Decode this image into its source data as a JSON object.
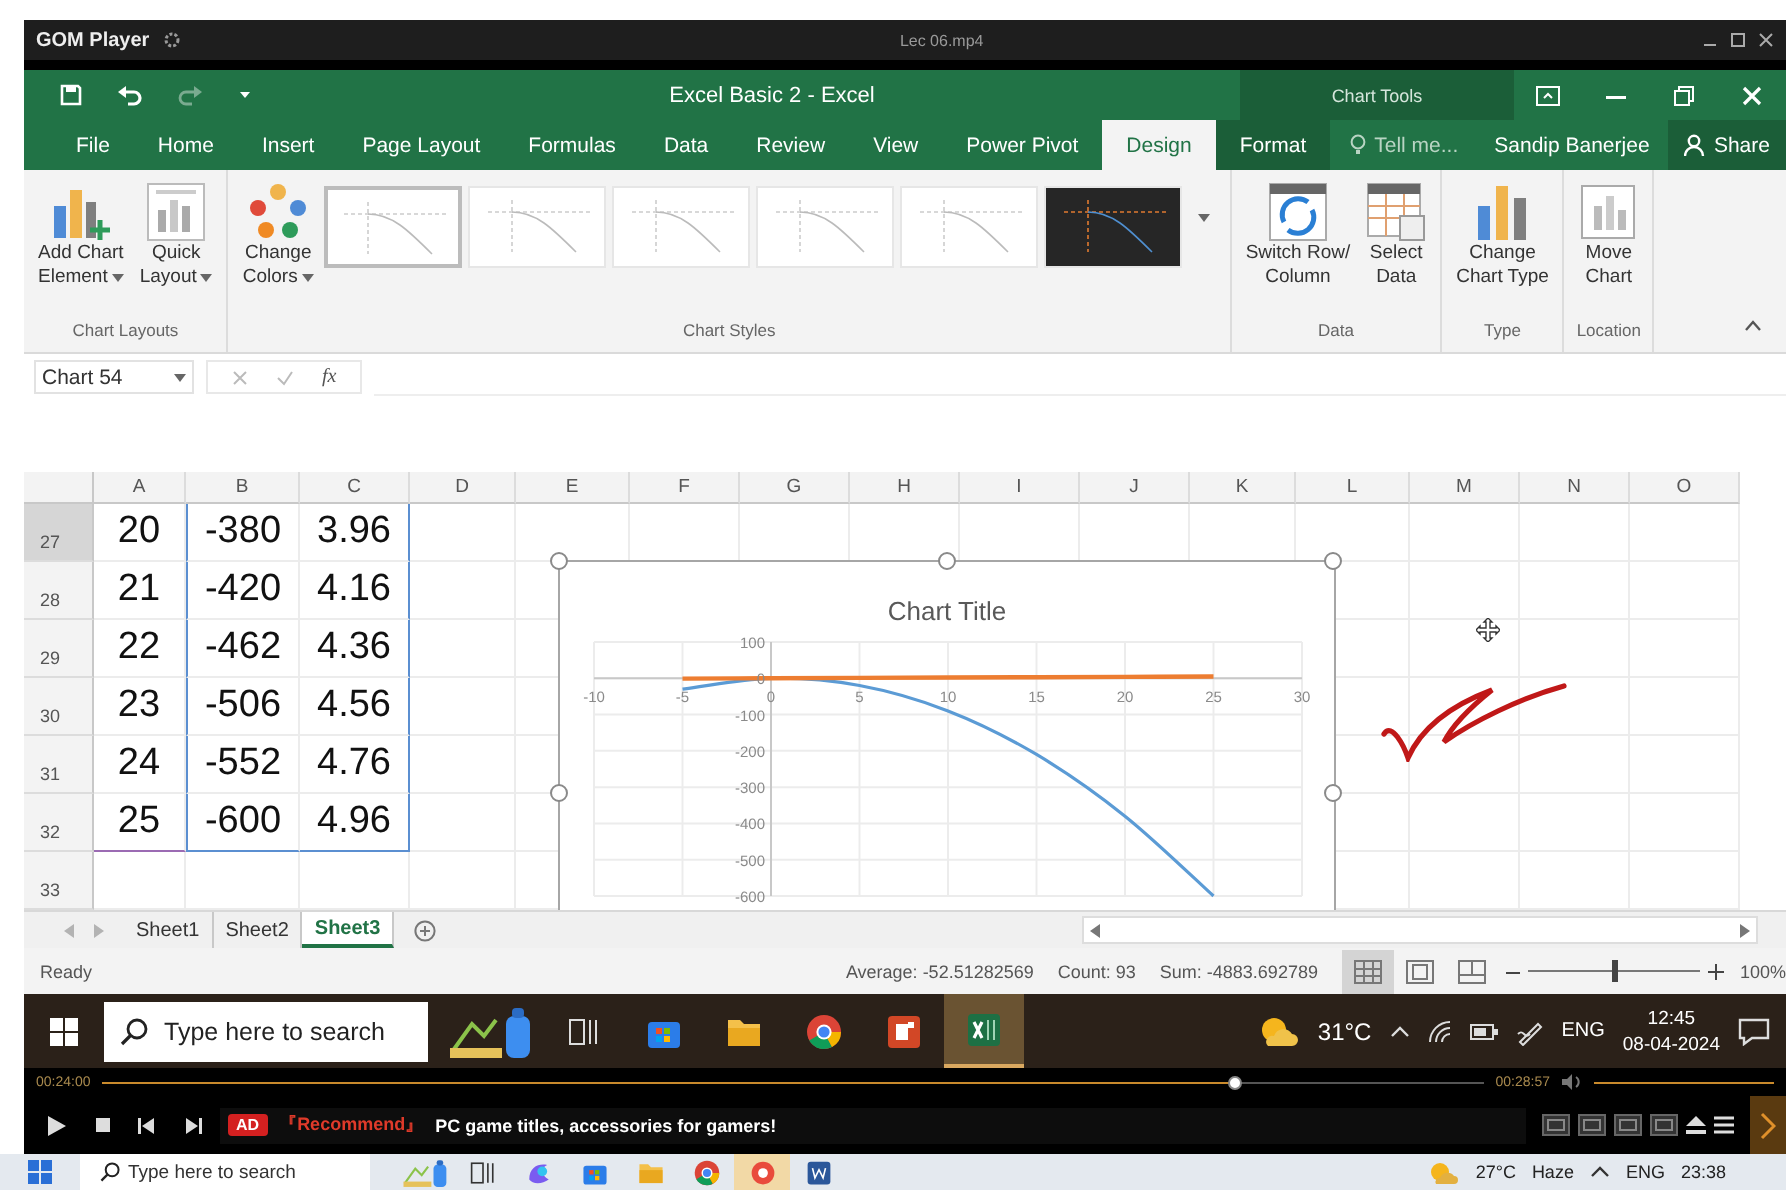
{
  "player": {
    "app_name": "GOM Player",
    "file_name": "Lec 06.mp4"
  },
  "excel": {
    "quick_access": [
      {
        "kind": "save",
        "disabled": false
      },
      {
        "kind": "undo",
        "disabled": false
      },
      {
        "kind": "redo",
        "disabled": true
      },
      {
        "kind": "customize",
        "disabled": false
      }
    ],
    "title": "Excel Basic 2 - Excel",
    "context_label": "Chart Tools",
    "tabs": [
      {
        "label": "File",
        "selected": false,
        "contextual": false
      },
      {
        "label": "Home",
        "selected": false,
        "contextual": false
      },
      {
        "label": "Insert",
        "selected": false,
        "contextual": false
      },
      {
        "label": "Page Layout",
        "selected": false,
        "contextual": false
      },
      {
        "label": "Formulas",
        "selected": false,
        "contextual": false
      },
      {
        "label": "Data",
        "selected": false,
        "contextual": false
      },
      {
        "label": "Review",
        "selected": false,
        "contextual": false
      },
      {
        "label": "View",
        "selected": false,
        "contextual": false
      },
      {
        "label": "Power Pivot",
        "selected": false,
        "contextual": false
      },
      {
        "label": "Design",
        "selected": true,
        "contextual": true
      },
      {
        "label": "Format",
        "selected": false,
        "contextual": true
      }
    ],
    "tell_me": "Tell me...",
    "user": "Sandip Banerjee",
    "share": "Share",
    "ribbon": [
      {
        "label": "Chart Layouts",
        "commands": [
          {
            "kind": "add-chart",
            "lines": [
              "Add Chart",
              "Element"
            ],
            "dropdown": true
          },
          {
            "kind": "quick-layout",
            "lines": [
              "Quick",
              "Layout"
            ],
            "dropdown": true
          }
        ]
      },
      {
        "label": "Chart Styles",
        "commands": [
          {
            "kind": "colors",
            "lines": [
              "Change",
              "Colors"
            ],
            "dropdown": true
          }
        ],
        "styles": [
          {
            "kind": "light",
            "selected": true
          },
          {
            "kind": "light",
            "selected": false
          },
          {
            "kind": "light",
            "selected": false
          },
          {
            "kind": "light",
            "selected": false
          },
          {
            "kind": "light",
            "selected": false
          },
          {
            "kind": "dark",
            "selected": false
          }
        ]
      },
      {
        "label": "Data",
        "commands": [
          {
            "kind": "switch",
            "lines": [
              "Switch Row/",
              "Column"
            ],
            "dropdown": false
          },
          {
            "kind": "select-data",
            "lines": [
              "Select",
              "Data"
            ],
            "dropdown": false
          }
        ]
      },
      {
        "label": "Type",
        "commands": [
          {
            "kind": "chart-type",
            "lines": [
              "Change",
              "Chart Type"
            ],
            "dropdown": false
          }
        ]
      },
      {
        "label": "Location",
        "commands": [
          {
            "kind": "move-chart",
            "lines": [
              "Move",
              "Chart"
            ],
            "dropdown": false
          }
        ]
      }
    ],
    "formula_bar": {
      "name_box": "Chart 54",
      "function_label": "fx"
    },
    "sheet": {
      "columns": [
        "A",
        "B",
        "C",
        "D",
        "E",
        "F",
        "G",
        "H",
        "I",
        "J",
        "K",
        "L",
        "M",
        "N",
        "O"
      ],
      "rows": [
        {
          "number": "27",
          "selected": true,
          "cells": [
            "20",
            "-380",
            "3.96"
          ]
        },
        {
          "number": "28",
          "selected": false,
          "cells": [
            "21",
            "-420",
            "4.16"
          ]
        },
        {
          "number": "29",
          "selected": false,
          "cells": [
            "22",
            "-462",
            "4.36"
          ]
        },
        {
          "number": "30",
          "selected": false,
          "cells": [
            "23",
            "-506",
            "4.56"
          ]
        },
        {
          "number": "31",
          "selected": false,
          "cells": [
            "24",
            "-552",
            "4.76"
          ]
        },
        {
          "number": "32",
          "selected": false,
          "cells": [
            "25",
            "-600",
            "4.96"
          ]
        },
        {
          "number": "33",
          "selected": false
        }
      ]
    },
    "chart": {
      "chart_data": {
        "type": "line",
        "title": "Chart Title",
        "x": [
          -5,
          0,
          5,
          10,
          15,
          20,
          25
        ],
        "series": [
          {
            "color": "#5b9bd5",
            "values": [
              -30,
              0,
              -20,
              -90,
              -210,
              -380,
              -600
            ]
          },
          {
            "color": "#ed7d31",
            "values": [
              -1,
              0,
              1,
              2,
              3,
              4,
              5
            ]
          }
        ],
        "grid": true,
        "xlim": [
          -10,
          30
        ],
        "ylim": [
          -600,
          100
        ],
        "xticks": [
          -10,
          -5,
          0,
          5,
          10,
          15,
          20,
          25,
          30
        ],
        "yticks": [
          -600,
          -500,
          -400,
          -300,
          -200,
          -100,
          0,
          100
        ]
      }
    },
    "sheet_tabs": [
      {
        "label": "Sheet1",
        "selected": false
      },
      {
        "label": "Sheet2",
        "selected": false
      },
      {
        "label": "Sheet3",
        "selected": true
      }
    ],
    "status_bar": {
      "mode": "Ready",
      "average": "Average: -52.51282569",
      "count": "Count: 93",
      "sum": "Sum: -4883.692789",
      "views": [
        {
          "kind": "normal",
          "selected": true
        },
        {
          "kind": "page-layout",
          "selected": false
        },
        {
          "kind": "page-break",
          "selected": false
        }
      ],
      "zoom": {
        "level": 0.5,
        "label": "100%"
      }
    }
  },
  "taskbar": {
    "search_placeholder": "Type here to search",
    "apps": [
      {
        "kind": "widget",
        "selected": false
      },
      {
        "kind": "task-view",
        "selected": false
      },
      {
        "kind": "store",
        "selected": false
      },
      {
        "kind": "explorer",
        "selected": false
      },
      {
        "kind": "chrome",
        "selected": false
      },
      {
        "kind": "powerpoint",
        "selected": false
      },
      {
        "kind": "excel",
        "selected": true
      }
    ],
    "temperature": "31°C",
    "language": "ENG",
    "time": "12:45",
    "date": "08-04-2024"
  },
  "player_controls": {
    "elapsed": "00:24:00",
    "progress": {
      "level": 0.82
    },
    "total": "00:28:57",
    "ad_badge": "AD",
    "ad_tag": "『Recommend』",
    "ad_text": "PC game titles, accessories for gamers!"
  },
  "host_taskbar": {
    "search_placeholder": "Type here to search",
    "apps": [
      {
        "kind": "widget",
        "selected": false
      },
      {
        "kind": "task-view",
        "selected": false
      },
      {
        "kind": "copilot",
        "selected": false
      },
      {
        "kind": "store",
        "selected": false
      },
      {
        "kind": "explorer",
        "selected": false
      },
      {
        "kind": "chrome",
        "selected": false
      },
      {
        "kind": "player",
        "selected": true
      },
      {
        "kind": "word",
        "selected": false
      }
    ],
    "temperature": "27°C",
    "condition": "Haze",
    "language": "ENG",
    "time": "23:38"
  }
}
